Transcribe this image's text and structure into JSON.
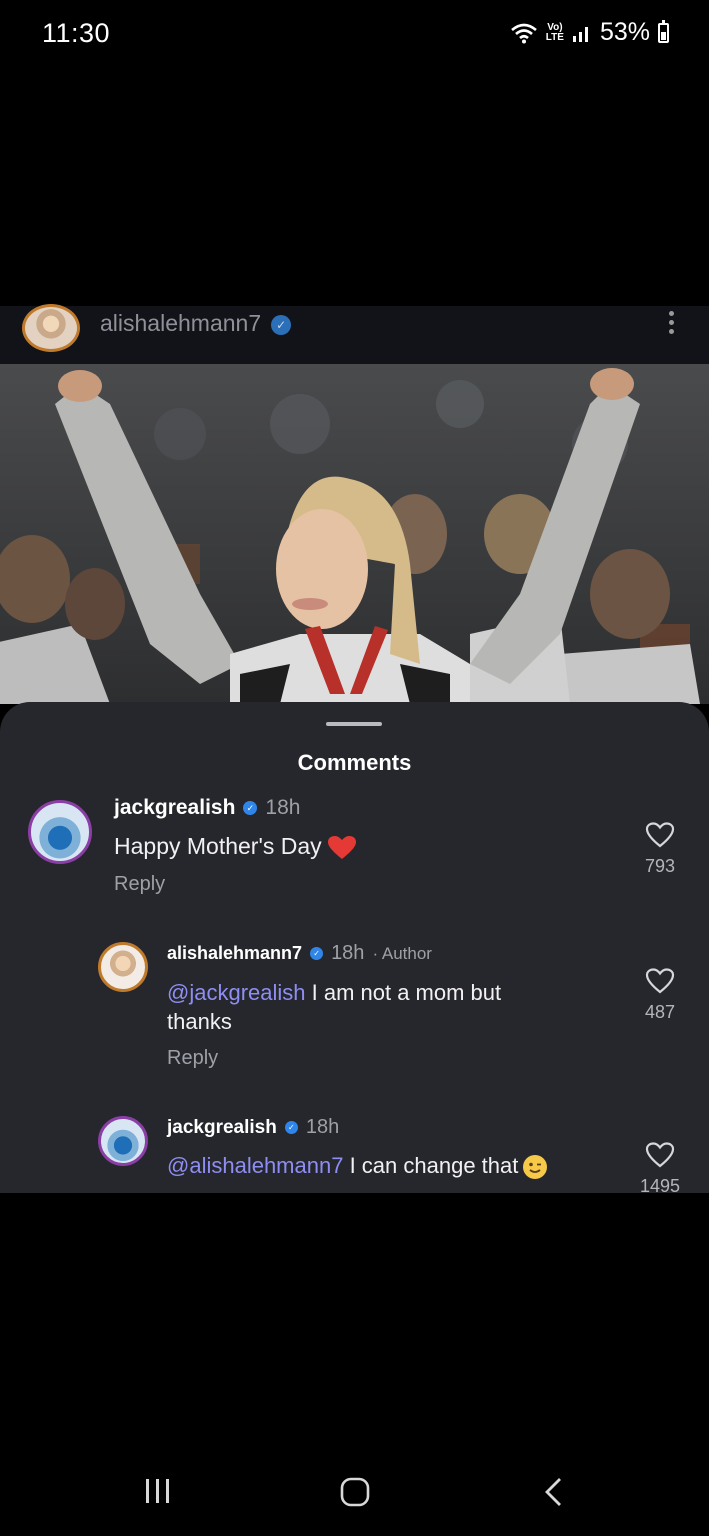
{
  "status_bar": {
    "time": "11:30",
    "network": "VoLTE",
    "battery": "53%",
    "battery_level_percent": 53
  },
  "post": {
    "username": "alishalehmann7",
    "verified": true
  },
  "comments_sheet": {
    "title": "Comments",
    "comments": [
      {
        "username": "jackgrealish",
        "time": "18h",
        "text": "Happy Mother's Day",
        "emoji": "red-heart",
        "reply_label": "Reply",
        "likes": "793"
      },
      {
        "username": "alishalehmann7",
        "time": "18h",
        "author_label": "· Author",
        "mention": "@jackgrealish",
        "text_line1": " I am not a mom but",
        "text_line2": "thanks",
        "reply_label": "Reply",
        "likes": "487"
      },
      {
        "username": "jackgrealish",
        "time": "18h",
        "mention": "@alishalehmann7",
        "text": " I can change that",
        "emoji": "winking-face",
        "likes": "1495"
      }
    ]
  },
  "colors": {
    "sheet_bg": "#26272c",
    "mention": "#8e8df2",
    "verified_blue": "#2f86e8"
  }
}
